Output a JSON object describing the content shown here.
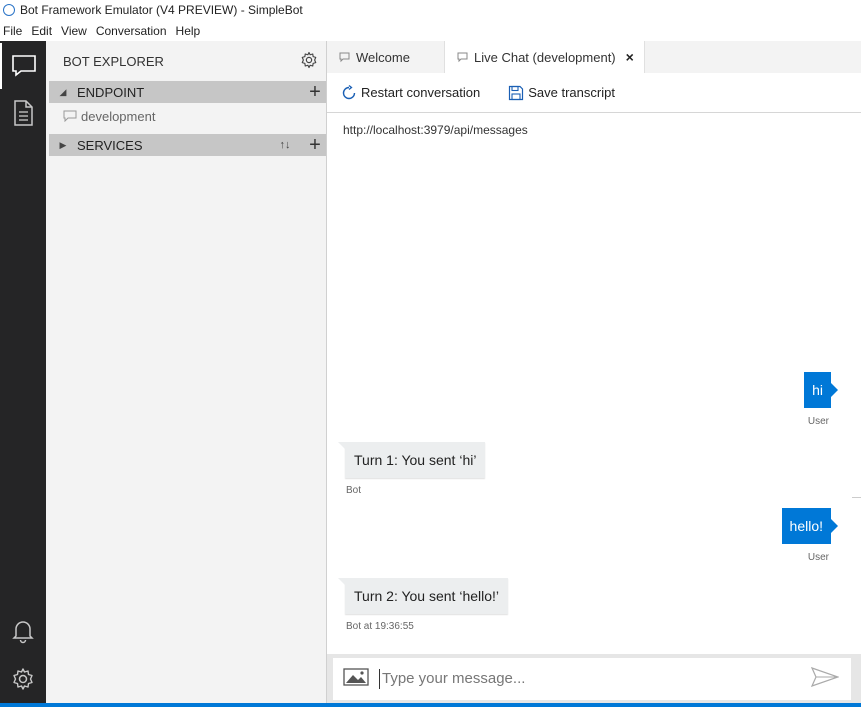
{
  "window": {
    "title": "Bot Framework Emulator (V4 PREVIEW) - SimpleBot"
  },
  "menu": [
    "File",
    "Edit",
    "View",
    "Conversation",
    "Help"
  ],
  "activity_bar": {
    "icons": [
      "chat-icon",
      "document-icon",
      "bell-icon",
      "gear-icon"
    ]
  },
  "explorer": {
    "title": "BOT EXPLORER",
    "endpoint_section": "ENDPOINT",
    "endpoint_item": "development",
    "services_section": "SERVICES"
  },
  "tabs": [
    {
      "label": "Welcome",
      "active": false
    },
    {
      "label": "Live Chat (development)",
      "active": true,
      "close": "×"
    }
  ],
  "toolbar": {
    "restart_label": "Restart conversation",
    "save_label": "Save transcript"
  },
  "chat": {
    "endpoint_url": "http://localhost:3979/api/messages",
    "messages": [
      {
        "from": "user",
        "text": "hi",
        "meta": "User"
      },
      {
        "from": "bot",
        "text": "Turn 1: You sent ‘hi’",
        "meta": "Bot"
      },
      {
        "from": "user",
        "text": "hello!",
        "meta": "User"
      },
      {
        "from": "bot",
        "text": "Turn 2: You sent ‘hello!’",
        "meta": "Bot at 19:36:55"
      }
    ]
  },
  "input": {
    "placeholder": "Type your message..."
  },
  "colors": {
    "accent": "#0078d7",
    "activity_bar": "#252526",
    "explorer_bg": "#f3f3f3"
  }
}
